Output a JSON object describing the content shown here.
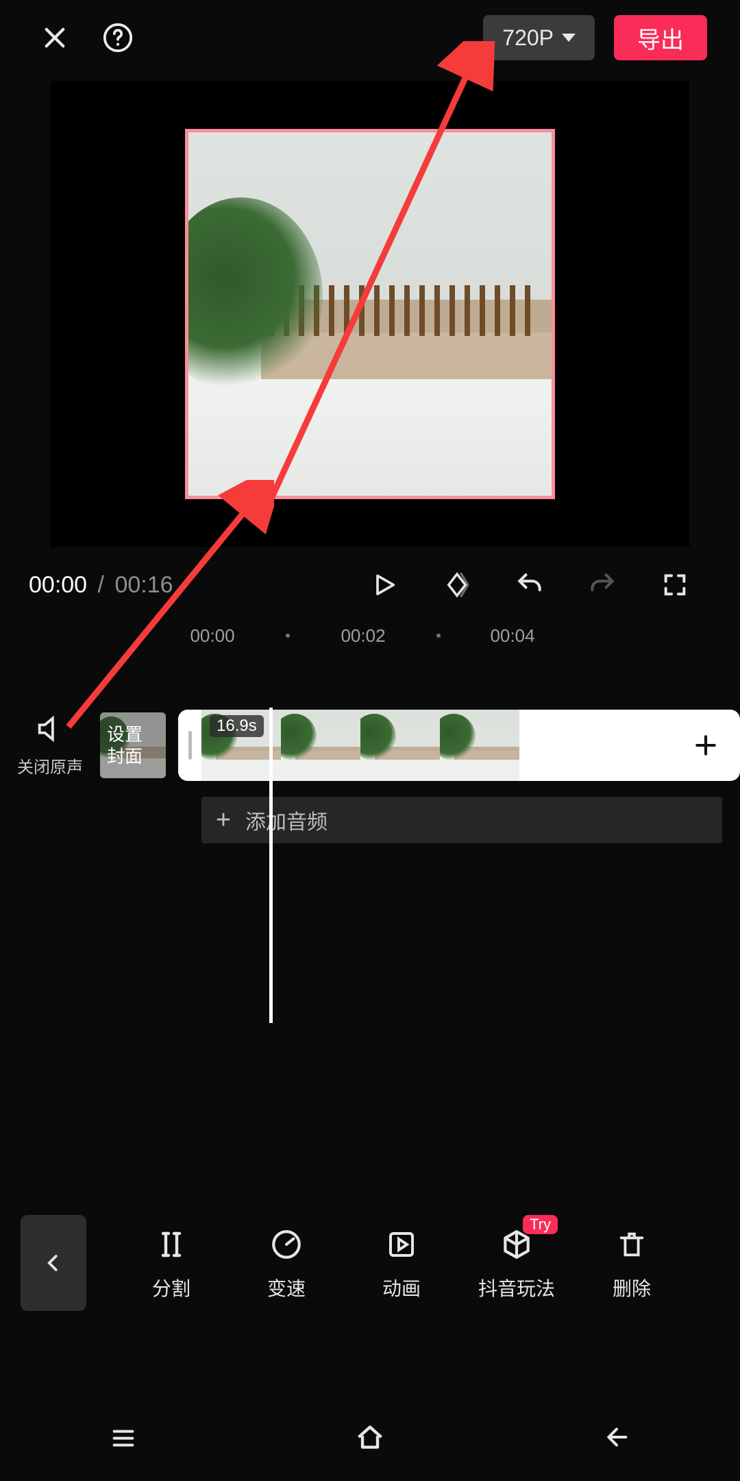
{
  "topbar": {
    "resolution": "720P",
    "export_label": "导出"
  },
  "playback": {
    "current": "00:00",
    "total": "00:16"
  },
  "ruler": {
    "marks": [
      "00:00",
      "00:02",
      "00:04"
    ]
  },
  "timeline": {
    "mute_label": "关闭原声",
    "cover_line1": "设置",
    "cover_line2": "封面",
    "clip_duration": "16.9s",
    "add_audio": "添加音频"
  },
  "tools": [
    {
      "id": "split",
      "label": "分割"
    },
    {
      "id": "speed",
      "label": "变速"
    },
    {
      "id": "anim",
      "label": "动画"
    },
    {
      "id": "douyin",
      "label": "抖音玩法",
      "badge": "Try"
    },
    {
      "id": "delete",
      "label": "删除"
    }
  ]
}
